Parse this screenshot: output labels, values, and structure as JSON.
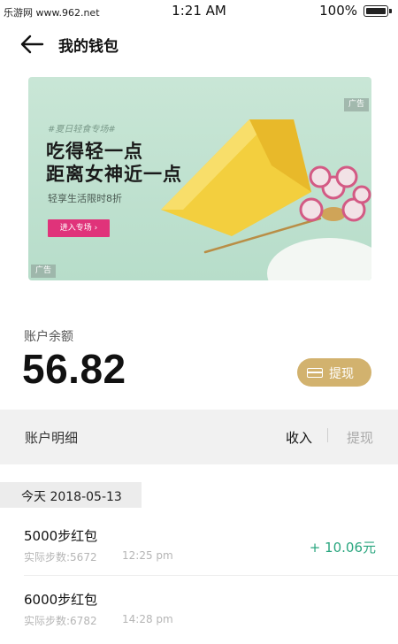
{
  "status_bar": {
    "watermark": "乐游网 www.962.net",
    "time": "1:21 AM",
    "battery": "100%"
  },
  "nav": {
    "title": "我的钱包"
  },
  "banner": {
    "tag": "#夏日轻食专场#",
    "headline_1": "吃得轻一点",
    "headline_2": "距离女神近一点",
    "subtitle": "轻享生活限时8折",
    "cta": "进入专场 ›",
    "ad_label": "广告"
  },
  "balance": {
    "label": "账户余额",
    "value": "56.82",
    "withdraw_label": "提现"
  },
  "details": {
    "title": "账户明细",
    "tabs": [
      {
        "label": "收入"
      },
      {
        "label": "提现"
      }
    ]
  },
  "date_group": {
    "label": "今天  2018-05-13"
  },
  "records": [
    {
      "title": "5000步红包",
      "steps": "实际步数:5672",
      "time": "12:25 pm",
      "amount": "+ 10.06元"
    },
    {
      "title": "6000步红包",
      "steps": "实际步数:6782",
      "time": "14:28 pm",
      "amount": ""
    }
  ],
  "colors": {
    "accent_gold": "#d2b26e",
    "amount_green": "#2aa67f",
    "cta_pink": "#e0337a"
  }
}
